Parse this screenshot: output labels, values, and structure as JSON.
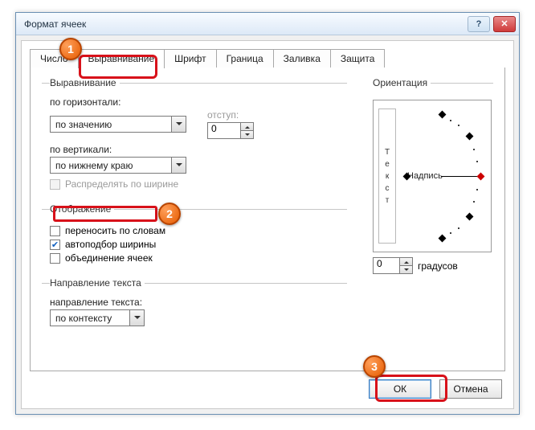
{
  "window": {
    "title": "Формат ячеек"
  },
  "tabs": [
    "Число",
    "Выравнивание",
    "Шрифт",
    "Граница",
    "Заливка",
    "Защита"
  ],
  "align": {
    "group": "Выравнивание",
    "h_label": "по горизонтали:",
    "h_value": "по значению",
    "indent_label": "отступ:",
    "indent_value": "0",
    "v_label": "по вертикали:",
    "v_value": "по нижнему краю",
    "justify_label": "Распределять по ширине"
  },
  "display": {
    "group": "Отображение",
    "wrap_label": "переносить по словам",
    "shrink_label": "автоподбор ширины",
    "merge_label": "объединение ячеек"
  },
  "direction": {
    "group": "Направление текста",
    "label": "направление текста:",
    "value": "по контексту"
  },
  "orientation": {
    "group": "Ориентация",
    "vtext": [
      "Т",
      "е",
      "к",
      "с",
      "т"
    ],
    "gauge_label": "Надпись",
    "degrees_value": "0",
    "degrees_label": "градусов"
  },
  "buttons": {
    "ok": "ОК",
    "cancel": "Отмена"
  },
  "callouts": {
    "c1": "1",
    "c2": "2",
    "c3": "3"
  }
}
